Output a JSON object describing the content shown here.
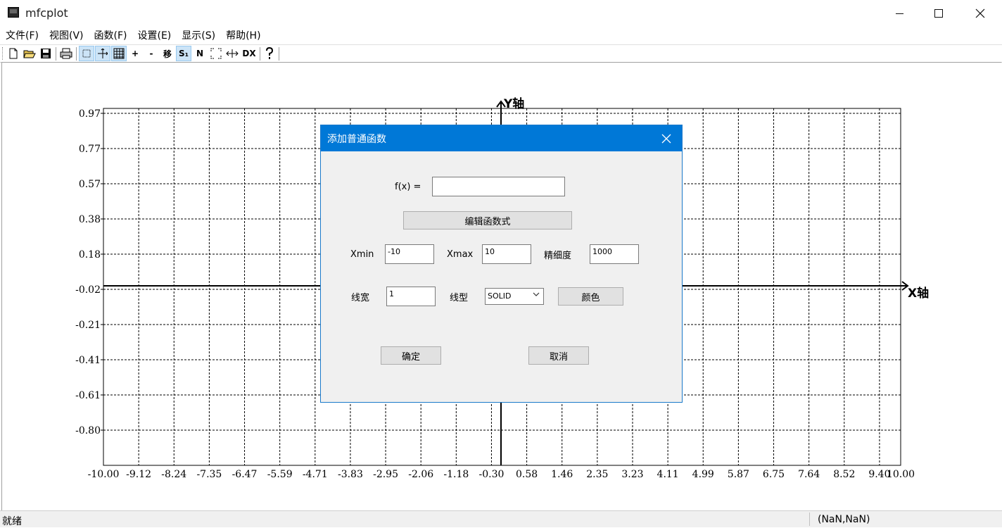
{
  "window": {
    "title": "mfcplot"
  },
  "menu": [
    "文件(F)",
    "视图(V)",
    "函数(F)",
    "设置(E)",
    "显示(S)",
    "帮助(H)"
  ],
  "toolbar": {
    "zoom_in": "+",
    "zoom_out": "-",
    "move": "移",
    "single": "S₁",
    "normal": "N",
    "dx": "DX",
    "help": "?"
  },
  "plot": {
    "x_axis_label": "X轴",
    "y_axis_label": "Y轴",
    "x_ticks": [
      "-10.00",
      "-9.12",
      "-8.24",
      "-7.35",
      "-6.47",
      "-5.59",
      "-4.71",
      "-3.83",
      "-2.95",
      "-2.06",
      "-1.18",
      "-0.30",
      "0.58",
      "1.46",
      "2.35",
      "3.23",
      "4.11",
      "4.99",
      "5.87",
      "6.75",
      "7.64",
      "8.52",
      "9.40",
      "10.00"
    ],
    "y_ticks": [
      "0.97",
      "0.77",
      "0.57",
      "0.38",
      "0.18",
      "-0.02",
      "-0.21",
      "-0.41",
      "-0.61",
      "-0.80"
    ]
  },
  "dialog": {
    "title": "添加普通函数",
    "fx_label": "f(x) =",
    "fx_value": "",
    "edit_button": "编辑函数式",
    "xmin_label": "Xmin",
    "xmin_value": "-10",
    "xmax_label": "Xmax",
    "xmax_value": "10",
    "precision_label": "精细度",
    "precision_value": "1000",
    "linewidth_label": "线宽",
    "linewidth_value": "1",
    "linetype_label": "线型",
    "linetype_value": "SOLID",
    "color_button": "颜色",
    "ok_button": "确定",
    "cancel_button": "取消"
  },
  "status": {
    "text": "就绪",
    "coords": "(NaN,NaN)"
  }
}
